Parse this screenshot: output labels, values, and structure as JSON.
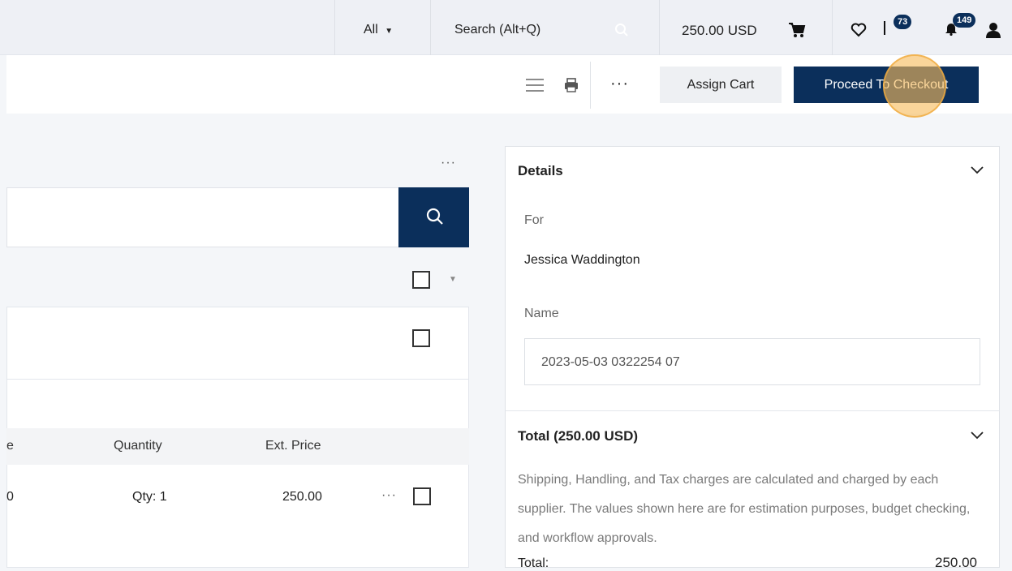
{
  "topbar": {
    "scope_label": "All",
    "search_placeholder": "Search (Alt+Q)",
    "cart_total": "250.00 USD",
    "flag_badge": "73",
    "notifications_badge": "149"
  },
  "actionbar": {
    "more_label": "···",
    "assign_cart": "Assign Cart",
    "proceed_checkout": "Proceed To Checkout"
  },
  "main": {
    "section_more": "···",
    "table": {
      "columns": [
        "e",
        "Quantity",
        "Ext. Price"
      ],
      "row": {
        "price_partial": "0",
        "quantity": "Qty: 1",
        "ext_price": "250.00",
        "more": "···"
      }
    }
  },
  "details": {
    "title": "Details",
    "for_label": "For",
    "for_value": "Jessica Waddington",
    "name_label": "Name",
    "name_value": "2023-05-03 0322254 07"
  },
  "totals": {
    "title": "Total (250.00 USD)",
    "description": "Shipping, Handling, and Tax charges are calculated and charged by each supplier. The values shown here are for estimation purposes, budget checking, and workflow approvals.",
    "total_label": "Total:",
    "total_value": "250.00"
  },
  "colors": {
    "primary": "#0b2f5b",
    "highlight": "#f7bc5c"
  }
}
